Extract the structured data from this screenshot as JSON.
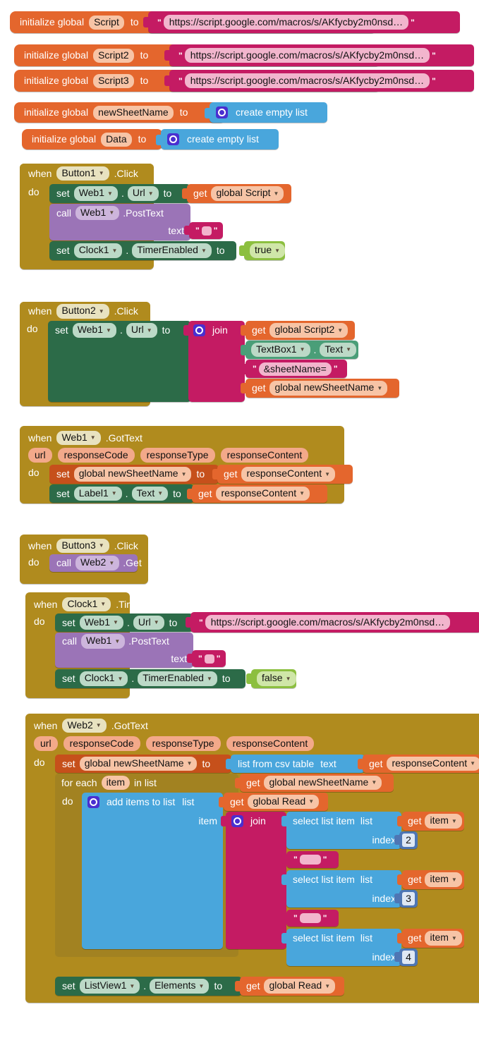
{
  "meta": {
    "app": "MIT App Inventor Blocks Editor",
    "screen": "Blocks workspace"
  },
  "palette": {
    "variable": "#e4662d",
    "text": "#c41b63",
    "list": "#49a6dc",
    "control": "#b08b1e",
    "setter": "#2c6b48",
    "call": "#9b74b7",
    "logic": "#8cbf3f",
    "math": "#4e76b4",
    "mutator": "#4a2fd0"
  },
  "words": {
    "initialize_global": "initialize global",
    "to": "to",
    "when": "when",
    "do": "do",
    "set": "set",
    "call": "call",
    "get": "get",
    "join": "join",
    "text": "text",
    "item": "item",
    "list": "list",
    "index": "index",
    "url": "url",
    "for_each": "for each",
    "in_list": "in list",
    "dot": ".",
    "create_empty_list": "create empty list",
    "add_items_to_list": "add items to list",
    "select_list_item": "select list item",
    "list_from_csv_table": "list from csv table",
    "quote": "\""
  },
  "globals": [
    {
      "name": "Script",
      "value_kind": "text",
      "value": "https://script.google.com/macros/s/AKfycby2m0nsd…"
    },
    {
      "name": "Script2",
      "value_kind": "text",
      "value": "https://script.google.com/macros/s/AKfycby2m0nsd…"
    },
    {
      "name": "Script3",
      "value_kind": "text",
      "value": "https://script.google.com/macros/s/AKfycby2m0nsd…"
    },
    {
      "name": "newSheetName",
      "value_kind": "list",
      "value": "create empty list"
    },
    {
      "name": "Data",
      "value_kind": "list",
      "value": "create empty list"
    }
  ],
  "events": {
    "button1_click": {
      "component": "Button1",
      "event": ".Click",
      "set_web1_url": {
        "component": "Web1",
        "property": "Url",
        "value": "global Script"
      },
      "call_posttext": {
        "component": "Web1",
        "method": ".PostText",
        "arg_label": "text"
      },
      "set_timer": {
        "component": "Clock1",
        "property": "TimerEnabled",
        "value": "true"
      }
    },
    "button2_click": {
      "component": "Button2",
      "event": ".Click",
      "set_web1_url": {
        "component": "Web1",
        "property": "Url"
      },
      "join_items": [
        {
          "kind": "get",
          "value": "global Script2"
        },
        {
          "kind": "component",
          "component": "TextBox1",
          "property": "Text"
        },
        {
          "kind": "text",
          "value": "&sheetName="
        },
        {
          "kind": "get",
          "value": "global newSheetName"
        }
      ]
    },
    "web1_gottext": {
      "component": "Web1",
      "event": ".GotText",
      "params": [
        "url",
        "responseCode",
        "responseType",
        "responseContent"
      ],
      "set_global": {
        "name": "global newSheetName",
        "value": "responseContent"
      },
      "set_label": {
        "component": "Label1",
        "property": "Text",
        "value": "responseContent"
      }
    },
    "button3_click": {
      "component": "Button3",
      "event": ".Click",
      "call": {
        "component": "Web2",
        "method": ".Get"
      }
    },
    "clock1_timer": {
      "component": "Clock1",
      "event": ".Timer",
      "set_web1_url": {
        "component": "Web1",
        "property": "Url",
        "value": "https://script.google.com/macros/s/AKfycby2m0nsd…"
      },
      "call_posttext": {
        "component": "Web1",
        "method": ".PostText",
        "arg_label": "text"
      },
      "set_timer": {
        "component": "Clock1",
        "property": "TimerEnabled",
        "value": "false"
      }
    },
    "web2_gottext": {
      "component": "Web2",
      "event": ".GotText",
      "params": [
        "url",
        "responseCode",
        "responseType",
        "responseContent"
      ],
      "set_global": {
        "name": "global newSheetName",
        "csv_label": "list from csv table",
        "csv_arg": "text",
        "value": "responseContent"
      },
      "for_each": {
        "var": "item",
        "list_value": "global newSheetName"
      },
      "add_items": {
        "list_value": "global Read"
      },
      "join_items": [
        {
          "kind": "select",
          "list_value": "item",
          "index": "2"
        },
        {
          "kind": "text",
          "value": ""
        },
        {
          "kind": "select",
          "list_value": "item",
          "index": "3"
        },
        {
          "kind": "text",
          "value": ""
        },
        {
          "kind": "select",
          "list_value": "item",
          "index": "4"
        }
      ],
      "set_listview": {
        "component": "ListView1",
        "property": "Elements",
        "value": "global Read"
      }
    }
  }
}
